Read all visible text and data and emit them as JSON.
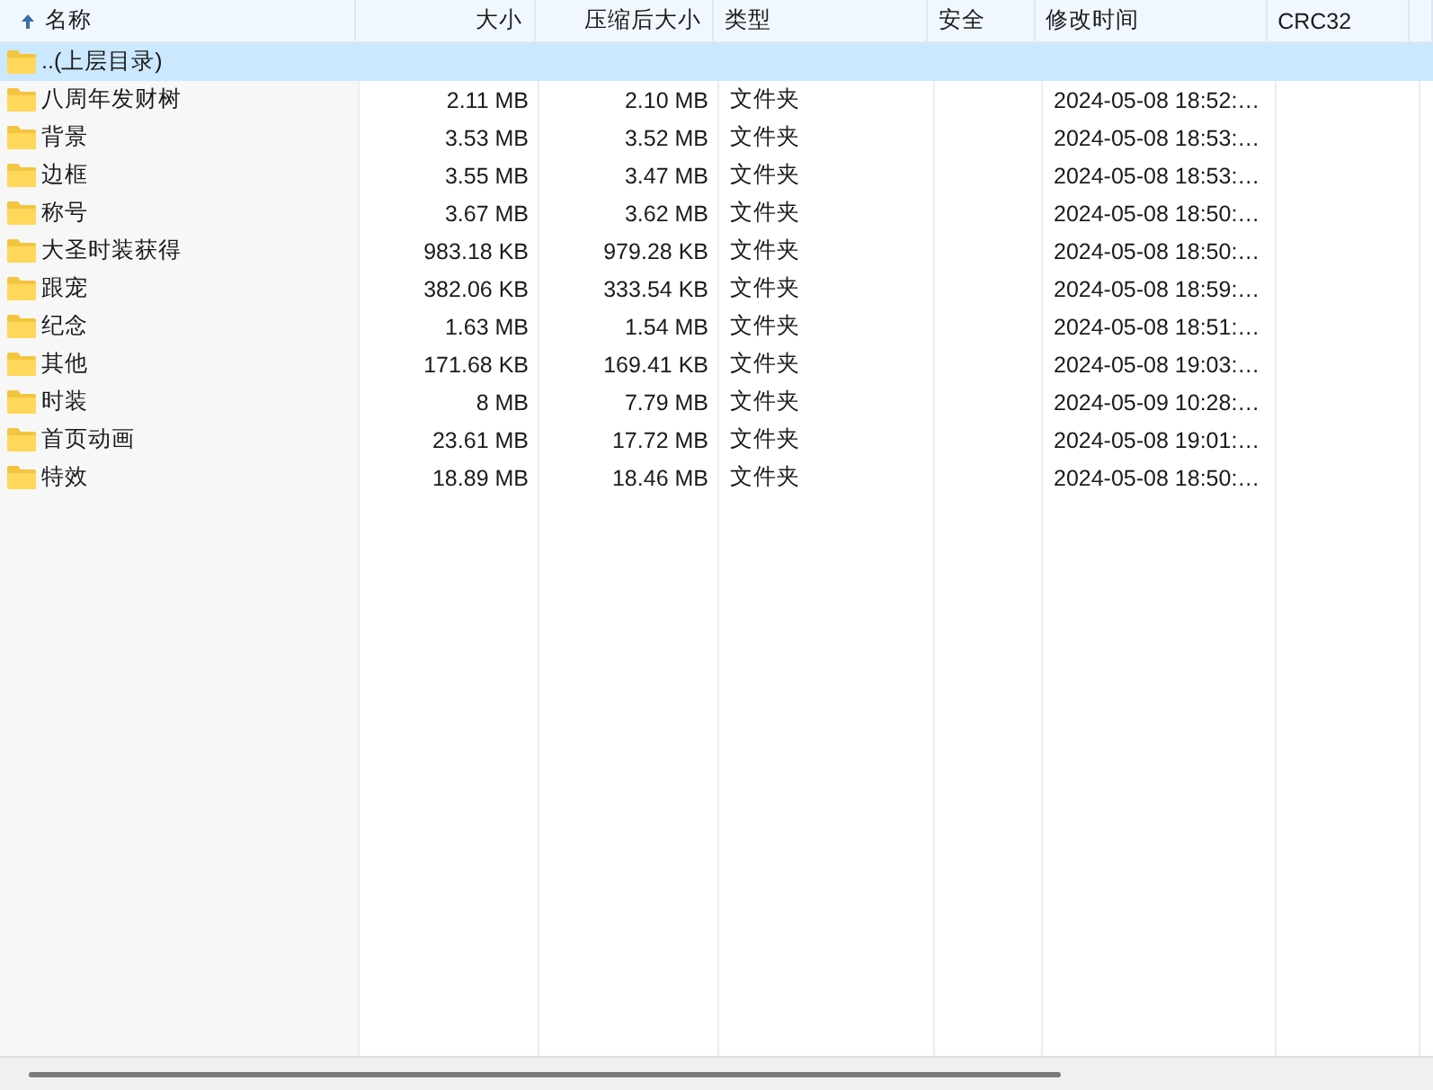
{
  "table": {
    "columns": [
      {
        "label": "名称",
        "sorted": true
      },
      {
        "label": "大小",
        "sorted": false
      },
      {
        "label": "压缩后大小",
        "sorted": false
      },
      {
        "label": "类型",
        "sorted": false
      },
      {
        "label": "安全",
        "sorted": false
      },
      {
        "label": "修改时间",
        "sorted": false
      },
      {
        "label": "CRC32",
        "sorted": false
      }
    ],
    "rows": [
      {
        "name": "..(上层目录)",
        "size": "",
        "packed": "",
        "type": "",
        "time": "",
        "selected": true
      },
      {
        "name": "八周年发财树",
        "size": "2.11 MB",
        "packed": "2.10 MB",
        "type": "文件夹",
        "time": "2024-05-08 18:52:…",
        "selected": false
      },
      {
        "name": "背景",
        "size": "3.53 MB",
        "packed": "3.52 MB",
        "type": "文件夹",
        "time": "2024-05-08 18:53:…",
        "selected": false
      },
      {
        "name": "边框",
        "size": "3.55 MB",
        "packed": "3.47 MB",
        "type": "文件夹",
        "time": "2024-05-08 18:53:…",
        "selected": false
      },
      {
        "name": "称号",
        "size": "3.67 MB",
        "packed": "3.62 MB",
        "type": "文件夹",
        "time": "2024-05-08 18:50:…",
        "selected": false
      },
      {
        "name": "大圣时装获得",
        "size": "983.18 KB",
        "packed": "979.28 KB",
        "type": "文件夹",
        "time": "2024-05-08 18:50:…",
        "selected": false
      },
      {
        "name": "跟宠",
        "size": "382.06 KB",
        "packed": "333.54 KB",
        "type": "文件夹",
        "time": "2024-05-08 18:59:…",
        "selected": false
      },
      {
        "name": "纪念",
        "size": "1.63 MB",
        "packed": "1.54 MB",
        "type": "文件夹",
        "time": "2024-05-08 18:51:…",
        "selected": false
      },
      {
        "name": "其他",
        "size": "171.68 KB",
        "packed": "169.41 KB",
        "type": "文件夹",
        "time": "2024-05-08 19:03:…",
        "selected": false
      },
      {
        "name": "时装",
        "size": "8 MB",
        "packed": "7.79 MB",
        "type": "文件夹",
        "time": "2024-05-09 10:28:…",
        "selected": false
      },
      {
        "name": "首页动画",
        "size": "23.61 MB",
        "packed": "17.72 MB",
        "type": "文件夹",
        "time": "2024-05-08 19:01:…",
        "selected": false
      },
      {
        "name": "特效",
        "size": "18.89 MB",
        "packed": "18.46 MB",
        "type": "文件夹",
        "time": "2024-05-08 18:50:…",
        "selected": false
      }
    ]
  }
}
